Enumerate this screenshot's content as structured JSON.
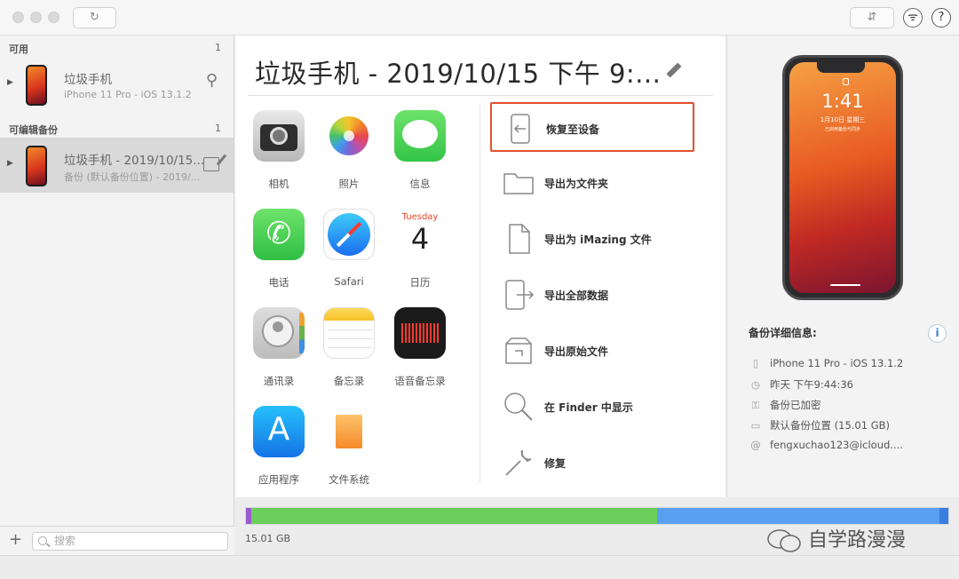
{
  "sidebar": {
    "section_available": "可用",
    "section_available_count": "1",
    "device": {
      "name": "垃圾手机",
      "sub": "iPhone 11 Pro - iOS 13.1.2"
    },
    "section_backups": "可编辑备份",
    "section_backups_count": "1",
    "backup": {
      "name": "垃圾手机 - 2019/10/15...",
      "sub": "备份 (默认备份位置) - 2019/..."
    },
    "search_placeholder": "搜索",
    "add_label": "+"
  },
  "main": {
    "title": "垃圾手机 - 2019/10/15 下午 9:...",
    "apps": [
      {
        "label": "相机",
        "icon": "camera-icon"
      },
      {
        "label": "照片",
        "icon": "photos-icon"
      },
      {
        "label": "信息",
        "icon": "messages-icon"
      },
      {
        "label": "电话",
        "icon": "phone-icon"
      },
      {
        "label": "Safari",
        "icon": "safari-icon"
      },
      {
        "label": "日历",
        "icon": "calendar-icon",
        "weekday": "Tuesday",
        "day": "4"
      },
      {
        "label": "通讯录",
        "icon": "contacts-icon"
      },
      {
        "label": "备忘录",
        "icon": "notes-icon"
      },
      {
        "label": "语音备忘录",
        "icon": "voice-memos-icon"
      },
      {
        "label": "应用程序",
        "icon": "app-store-icon"
      },
      {
        "label": "文件系统",
        "icon": "file-system-icon"
      }
    ],
    "actions": [
      {
        "label": "恢复至设备",
        "icon": "restore-to-device-icon"
      },
      {
        "label": "导出为文件夹",
        "icon": "folder-icon"
      },
      {
        "label": "导出为 iMazing 文件",
        "icon": "document-icon"
      },
      {
        "label": "导出全部数据",
        "icon": "export-all-icon"
      },
      {
        "label": "导出原始文件",
        "icon": "export-raw-icon"
      },
      {
        "label": "在 Finder 中显示",
        "icon": "magnifier-icon"
      },
      {
        "label": "修复",
        "icon": "wrench-icon"
      }
    ]
  },
  "detail": {
    "lock_time": "1:41",
    "lock_date": "1月10日 星期三",
    "lock_sub": "已启用备份与同步",
    "title": "备份详细信息:",
    "rows": [
      {
        "icon": "phone-outline-icon",
        "text": "iPhone 11 Pro - iOS 13.1.2"
      },
      {
        "icon": "clock-icon",
        "text": "昨天 下午9:44:36"
      },
      {
        "icon": "key-icon",
        "text": "备份已加密"
      },
      {
        "icon": "folder-outline-icon",
        "text": "默认备份位置 (15.01 GB)"
      },
      {
        "icon": "at-icon",
        "text": "fengxuchao123@icloud...."
      }
    ],
    "info_label": "i"
  },
  "storage": {
    "label": "15.01 GB",
    "segments": [
      {
        "color": "#9b59d0",
        "fraction": 0.007
      },
      {
        "color": "#6ccf5c",
        "fraction": 0.578
      },
      {
        "color": "#5aa0f0",
        "fraction": 0.403
      },
      {
        "color": "#3b7de0",
        "fraction": 0.012
      }
    ]
  },
  "watermark": "自学路漫漫",
  "colors": {
    "highlight": "#e0512d"
  }
}
